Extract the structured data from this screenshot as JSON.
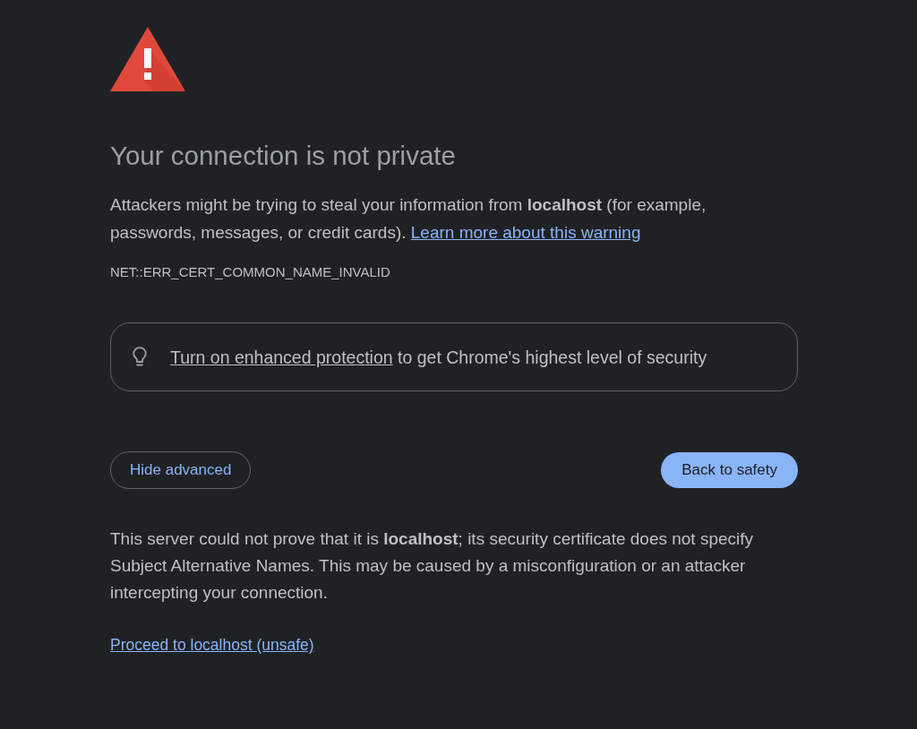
{
  "warning": {
    "title": "Your connection is not private",
    "message": "Attackers might be trying to steal your information from **localhost** (for example, passwords, messages, or credit cards).",
    "learn_more_link": "Learn more about this warning",
    "error_code": "NET::ERR_CERT_COMMON_NAME_INVALID"
  },
  "enhanced_protection": {
    "link": "Turn on enhanced protection",
    "text": "to get Chrome's highest level of security"
  },
  "buttons": {
    "secondary": "Hide advanced",
    "primary": "Back to safety"
  },
  "details": {
    "message": "This server could not prove that it is **localhost**; its security certificate does not specify Subject Alternative Names. This may be caused by a misconfiguration or an attacker intercepting your connection.",
    "proceed_link": "Proceed to localhost (unsafe)"
  }
}
